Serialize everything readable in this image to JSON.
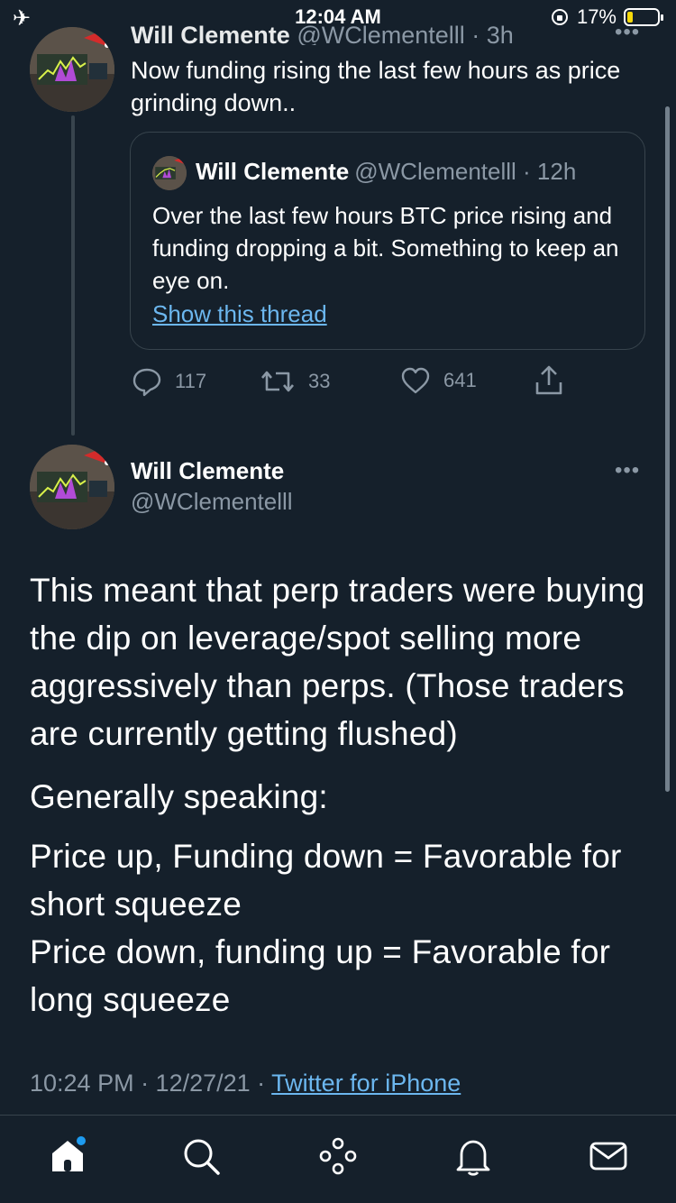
{
  "status_bar": {
    "time": "12:04 AM",
    "battery_percent": "17%",
    "battery_level": 0.17
  },
  "tweet1": {
    "name": "Will Clemente",
    "handle_time": "@WClementelll · 3h",
    "text": "Now funding rising the last few hours as price grinding down..",
    "quoted": {
      "name": "Will Clemente",
      "meta": "@WClementelll · 12h",
      "text": "Over the last few hours BTC price rising and funding dropping a bit. Something to keep an eye on.",
      "link": "Show this thread"
    },
    "actions": {
      "replies": "117",
      "retweets": "33",
      "likes": "641"
    }
  },
  "main_tweet": {
    "name": "Will Clemente",
    "handle": "@WClementelll",
    "para1": "This meant that perp traders were buying the dip on leverage/spot selling more aggressively than perps. (Those traders are currently getting flushed)",
    "para2": "Generally speaking:",
    "line3a": "Price up, Funding down = Favorable for short squeeze",
    "line3b": "Price down, funding up = Favorable for long squeeze",
    "time_date": "10:24 PM · 12/27/21 · ",
    "source": "Twitter for iPhone"
  },
  "icons": {
    "nav": [
      "home-icon",
      "search-icon",
      "spaces-icon",
      "notifications-icon",
      "messages-icon"
    ],
    "accent": "#1d9bf0",
    "background": "#15202b"
  }
}
